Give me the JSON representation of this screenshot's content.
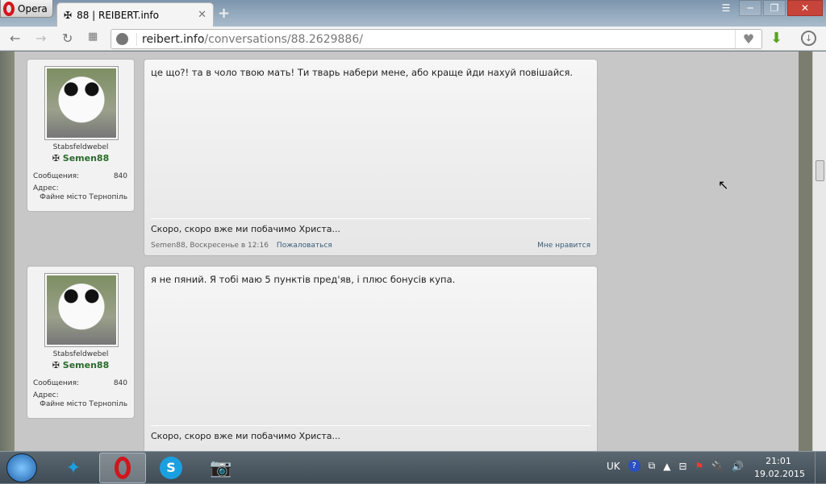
{
  "browser": {
    "menu_label": "Opera",
    "tab_title": "88 | REIBERT.info",
    "url_host": "reibert.info",
    "url_path": "/conversations/88.2629886/"
  },
  "posts": [
    {
      "user_title": "Stabsfeldwebel",
      "username": "Semen88",
      "messages_label": "Сообщения:",
      "messages_count": "840",
      "address_label": "Адрес:",
      "address": "Файне місто Тернопіль",
      "text": "це що?! та в чоло твою мать! Ти тварь набери мене, або краще йди нахуй повішайся.",
      "signature": "Скоро, скоро вже ми побачимо Христа...",
      "meta": "Semen88, Воскресенье в 12:16",
      "report": "Пожаловаться",
      "like": "Мне нравится"
    },
    {
      "user_title": "Stabsfeldwebel",
      "username": "Semen88",
      "messages_label": "Сообщения:",
      "messages_count": "840",
      "address_label": "Адрес:",
      "address": "Файне місто Тернопіль",
      "text": "я не пяний. Я тобі маю 5 пунктів пред'яв, і плюс бонусів купа.",
      "signature": "Скоро, скоро вже ми побачимо Христа..."
    }
  ],
  "taskbar": {
    "lang": "UK",
    "time": "21:01",
    "date": "19.02.2015"
  }
}
